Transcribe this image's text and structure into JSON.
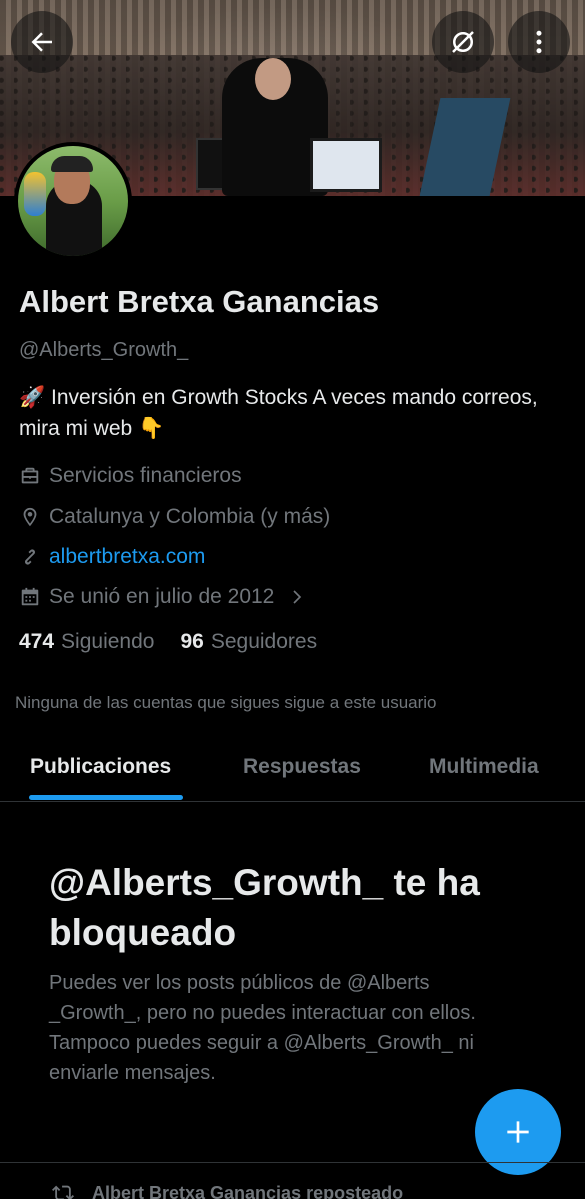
{
  "profile": {
    "name": "Albert Bretxa Ganancias",
    "handle": "@Alberts_Growth_",
    "bio_text": "Inversión en Growth Stocks A veces mando correos, mira mi web",
    "bio_emoji_start": "🚀",
    "bio_emoji_end": "👇",
    "category": "Servicios financieros",
    "location": "Catalunya y Colombia (y más)",
    "website": "albertbretxa.com",
    "joined": "Se unió en julio de 2012"
  },
  "stats": {
    "following_count": "474",
    "following_label": "Siguiendo",
    "followers_count": "96",
    "followers_label": "Seguidores"
  },
  "mutual_text": "Ninguna de las cuentas que sigues sigue a este usuario",
  "tabs": [
    {
      "label": "Publicaciones",
      "active": true
    },
    {
      "label": "Respuestas",
      "active": false
    },
    {
      "label": "Multimedia",
      "active": false
    }
  ],
  "blocked": {
    "title": "@Alberts_Growth_ te ha bloqueado",
    "text": "Puedes ver los posts públicos de @Alberts _Growth_, pero no puedes interactuar con ellos. Tampoco puedes seguir a @Alberts_Growth_ ni enviarle mensajes."
  },
  "repost_text": "Albert Bretxa Ganancias reposteado",
  "icons": {
    "back": "back-arrow-icon",
    "grok": "grok-icon",
    "more": "more-vertical-icon",
    "category": "briefcase-icon",
    "location": "location-pin-icon",
    "link": "link-icon",
    "calendar": "calendar-icon",
    "fab": "plus-icon",
    "repost": "repost-icon"
  },
  "colors": {
    "accent": "#1d9bf0",
    "text_primary": "#e7e9ea",
    "text_secondary": "#71767b",
    "background": "#000000"
  }
}
